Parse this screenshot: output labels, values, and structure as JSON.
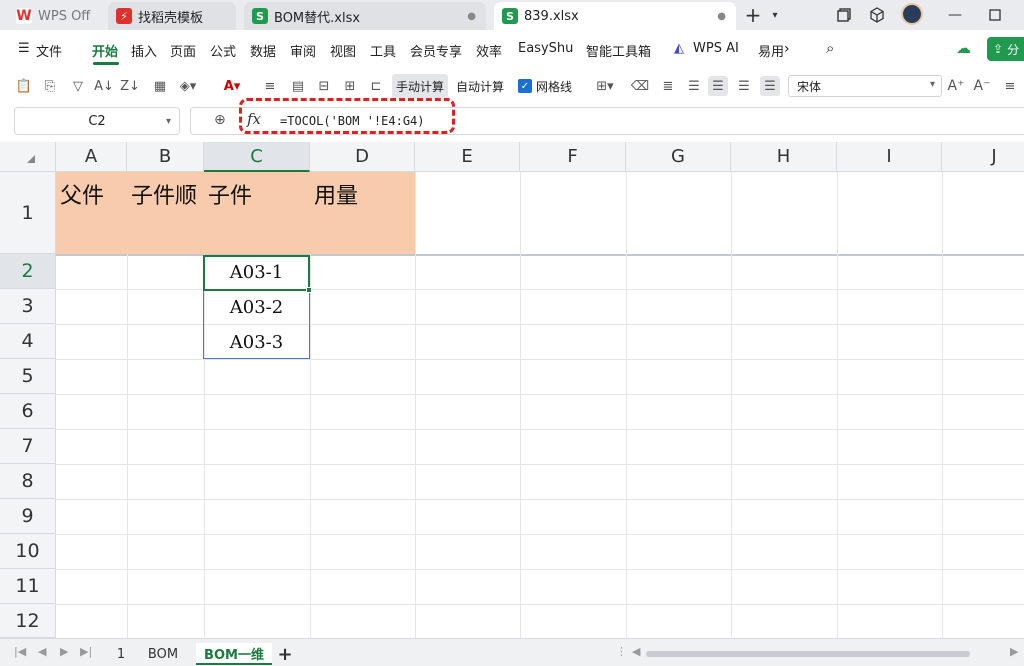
{
  "tabs": [
    {
      "label": "WPS Off",
      "icon": "W",
      "color": "#e0302e"
    },
    {
      "label": "找稻壳模板",
      "icon": "⚡",
      "color": "#e0302e"
    },
    {
      "label": "BOM替代.xlsx",
      "icon": "S",
      "color": "#1f9a4f"
    },
    {
      "label": "839.xlsx",
      "icon": "S",
      "color": "#1f9a4f"
    }
  ],
  "menu": {
    "file": "文件",
    "items": [
      "开始",
      "插入",
      "页面",
      "公式",
      "数据",
      "审阅",
      "视图",
      "工具",
      "会员专享",
      "效率",
      "EasyShu",
      "智能工具箱"
    ],
    "wps_ai": "WPS AI",
    "more": "易用",
    "share": "分"
  },
  "toolbar": {
    "manual_calc": "手动计算",
    "auto_calc": "自动计算",
    "gridlines": "网格线",
    "font": "宋体"
  },
  "formula_bar": {
    "cell_ref": "C2",
    "formula": "=TOCOL('BOM '!E4:G4)"
  },
  "columns": [
    "A",
    "B",
    "C",
    "D",
    "E",
    "F",
    "G",
    "H",
    "I",
    "J"
  ],
  "rows": [
    "1",
    "2",
    "3",
    "4",
    "5",
    "6",
    "7",
    "8",
    "9",
    "10",
    "11",
    "12"
  ],
  "headers": {
    "A": "父件",
    "B": "子件顺",
    "C": "子件",
    "D": "用量"
  },
  "values": [
    "A03-1",
    "A03-2",
    "A03-3"
  ],
  "sheets": [
    "1",
    "BOM",
    "BOM一维"
  ],
  "colors": {
    "accent": "#1a7a3f",
    "header_fill": "#f8cbad",
    "highlight": "#e02020"
  }
}
